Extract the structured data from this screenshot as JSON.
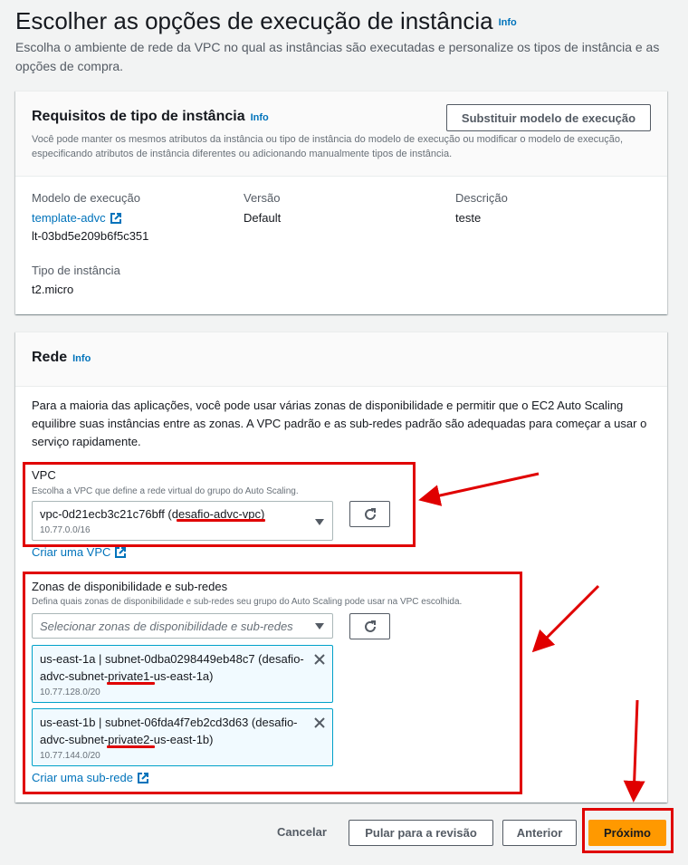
{
  "header": {
    "title": "Escolher as opções de execução de instância",
    "info": "Info",
    "description": "Escolha o ambiente de rede da VPC no qual as instâncias são executadas e personalize os tipos de instância e as opções de compra."
  },
  "instance_requirements": {
    "title": "Requisitos de tipo de instância",
    "info": "Info",
    "override_button": "Substituir modelo de execução",
    "description": "Você pode manter os mesmos atributos da instância ou tipo de instância do modelo de execução ou modificar o modelo de execução, especificando atributos de instância diferentes ou adicionando manualmente tipos de instância.",
    "template_label": "Modelo de execução",
    "template_link": "template-advc",
    "template_id": "lt-03bd5e209b6f5c351",
    "version_label": "Versão",
    "version_value": "Default",
    "description_label": "Descrição",
    "description_value": "teste",
    "instance_type_label": "Tipo de instância",
    "instance_type_value": "t2.micro"
  },
  "network": {
    "title": "Rede",
    "info": "Info",
    "intro": "Para a maioria das aplicações, você pode usar várias zonas de disponibilidade e permitir que o EC2 Auto Scaling equilibre suas instâncias entre as zonas. A VPC padrão e as sub-redes padrão são adequadas para começar a usar o serviço rapidamente.",
    "vpc": {
      "label": "VPC",
      "help": "Escolha a VPC que define a rede virtual do grupo do Auto Scaling.",
      "selected": "vpc-0d21ecb3c21c76bff (desafio-advc-vpc)",
      "cidr": "10.77.0.0/16",
      "create_link": "Criar uma VPC"
    },
    "zones": {
      "label": "Zonas de disponibilidade e sub-redes",
      "help": "Defina quais zonas de disponibilidade e sub-redes seu grupo do Auto Scaling pode usar na VPC escolhida.",
      "placeholder": "Selecionar zonas de disponibilidade e sub-redes",
      "tokens": [
        {
          "line1": "us-east-1a | subnet-0dba0298449eb48c7 (desafio-",
          "line2": "advc-subnet-private1-us-east-1a)",
          "cidr": "10.77.128.0/20"
        },
        {
          "line1": "us-east-1b | subnet-06fda4f7eb2cd3d63 (desafio-",
          "line2": "advc-subnet-private2-us-east-1b)",
          "cidr": "10.77.144.0/20"
        }
      ],
      "create_link": "Criar uma sub-rede"
    }
  },
  "footer": {
    "cancel": "Cancelar",
    "skip": "Pular para a revisão",
    "previous": "Anterior",
    "next": "Próximo"
  },
  "colors": {
    "accent": "#ff9900",
    "link": "#0073bb",
    "annotation": "#e00000"
  }
}
